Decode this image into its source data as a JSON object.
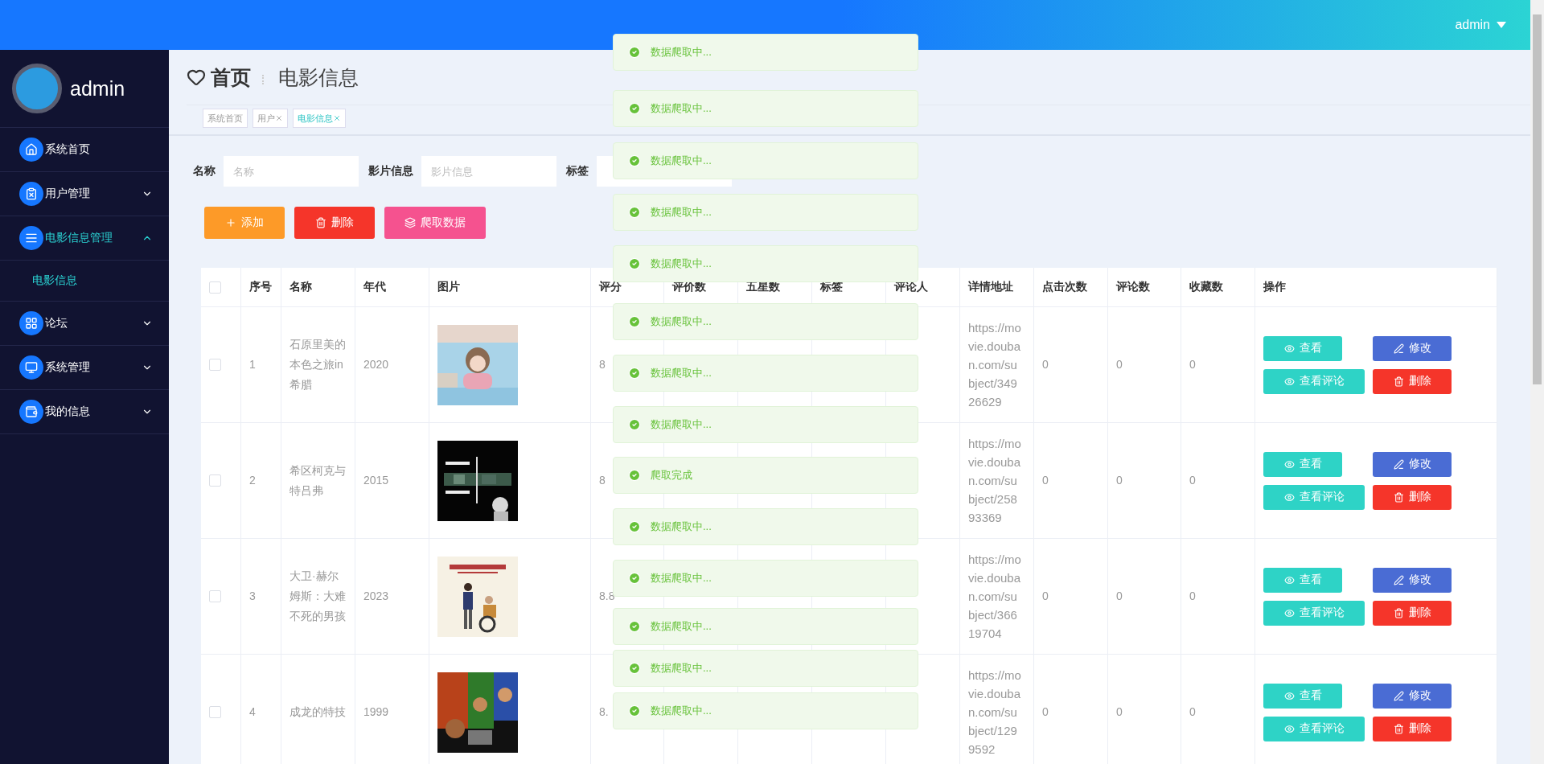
{
  "topbar": {
    "user": "admin"
  },
  "sidebar": {
    "user": "admin",
    "menu": [
      {
        "label": "系统首页",
        "kind": "link"
      },
      {
        "label": "用户管理",
        "kind": "group",
        "expanded": false
      },
      {
        "label": "电影信息管理",
        "kind": "group",
        "expanded": true,
        "children": [
          {
            "label": "电影信息",
            "selected": true
          }
        ]
      },
      {
        "label": "论坛",
        "kind": "group",
        "expanded": false
      },
      {
        "label": "系统管理",
        "kind": "group",
        "expanded": false
      },
      {
        "label": "我的信息",
        "kind": "group",
        "expanded": false
      }
    ]
  },
  "page_header": {
    "title": "首页",
    "subtitle": "电影信息"
  },
  "tabs": [
    {
      "label": "系统首页",
      "closable": false,
      "selected": false
    },
    {
      "label": "用户",
      "closable": true,
      "selected": false
    },
    {
      "label": "电影信息",
      "closable": true,
      "selected": true
    }
  ],
  "filters": [
    {
      "label": "名称",
      "placeholder": "名称"
    },
    {
      "label": "影片信息",
      "placeholder": "影片信息"
    },
    {
      "label": "标签"
    }
  ],
  "actions": [
    {
      "label": "添加",
      "kind": "add"
    },
    {
      "label": "删除",
      "kind": "delete"
    },
    {
      "label": "爬取数据",
      "kind": "crawl"
    }
  ],
  "table": {
    "select_all": {
      "checked": false
    },
    "columns": [
      "序号",
      "名称",
      "年代",
      "图片",
      "评分",
      "评价数",
      "五星数",
      "标签",
      "评论人",
      "详情地址",
      "点击次数",
      "评论数",
      "收藏数",
      "操作"
    ],
    "rows": [
      {
        "selected": false,
        "index": "1",
        "name": "石原里美的本色之旅in希腊",
        "year": "2020",
        "score": "8",
        "url": "https://movie.douban.com/subject/34926629",
        "clicks": "0",
        "comments": "0",
        "favorites": "0",
        "buttons": [
          {
            "label": "查看",
            "kind": "view"
          },
          {
            "label": "修改",
            "kind": "edit"
          },
          {
            "label": "查看评论",
            "kind": "comments"
          },
          {
            "label": "删除",
            "kind": "delete"
          }
        ]
      },
      {
        "selected": false,
        "index": "2",
        "name": "希区柯克与特吕弗",
        "year": "2015",
        "score": "8",
        "url": "https://movie.douban.com/subject/25893369",
        "clicks": "0",
        "comments": "0",
        "favorites": "0",
        "buttons": [
          {
            "label": "查看",
            "kind": "view"
          },
          {
            "label": "修改",
            "kind": "edit"
          },
          {
            "label": "查看评论",
            "kind": "comments"
          },
          {
            "label": "删除",
            "kind": "delete"
          }
        ]
      },
      {
        "selected": false,
        "index": "3",
        "name": "大卫·赫尔姆斯：大难不死的男孩",
        "year": "2023",
        "score": "8.8",
        "url": "https://movie.douban.com/subject/36619704",
        "clicks": "0",
        "comments": "0",
        "favorites": "0",
        "buttons": [
          {
            "label": "查看",
            "kind": "view"
          },
          {
            "label": "修改",
            "kind": "edit"
          },
          {
            "label": "查看评论",
            "kind": "comments"
          },
          {
            "label": "删除",
            "kind": "delete"
          }
        ]
      },
      {
        "selected": false,
        "index": "4",
        "name": "成龙的特技",
        "year": "1999",
        "score": "8.",
        "url": "https://movie.douban.com/subject/1299592",
        "clicks": "0",
        "comments": "0",
        "favorites": "0",
        "buttons": [
          {
            "label": "查看",
            "kind": "view"
          },
          {
            "label": "修改",
            "kind": "edit"
          },
          {
            "label": "查看评论",
            "kind": "comments"
          },
          {
            "label": "删除",
            "kind": "delete"
          }
        ]
      }
    ]
  },
  "notifications": [
    {
      "message": "数据爬取中...",
      "kind": "success"
    },
    {
      "message": "数据爬取中...",
      "kind": "success"
    },
    {
      "message": "数据爬取中...",
      "kind": "success"
    },
    {
      "message": "数据爬取中...",
      "kind": "success"
    },
    {
      "message": "数据爬取中...",
      "kind": "success"
    },
    {
      "message": "数据爬取中...",
      "kind": "success"
    },
    {
      "message": "数据爬取中...",
      "kind": "success"
    },
    {
      "message": "数据爬取中...",
      "kind": "success"
    },
    {
      "message": "爬取完成",
      "kind": "success"
    },
    {
      "message": "数据爬取中...",
      "kind": "success"
    },
    {
      "message": "数据爬取中...",
      "kind": "success"
    },
    {
      "message": "数据爬取中...",
      "kind": "success"
    },
    {
      "message": "数据爬取中...",
      "kind": "success"
    },
    {
      "message": "数据爬取中...",
      "kind": "success"
    }
  ]
}
